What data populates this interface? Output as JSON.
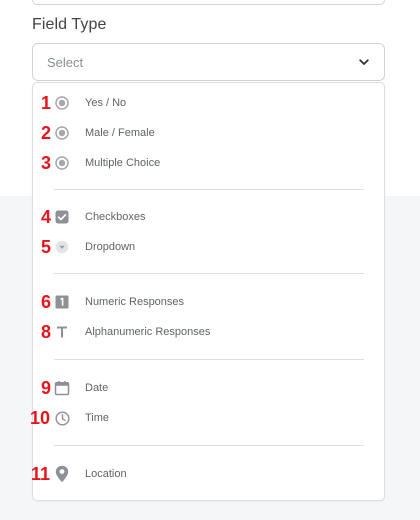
{
  "field_type": {
    "label": "Field Type",
    "select_value": "Select"
  },
  "options": [
    {
      "number": "1",
      "label": "Yes / No",
      "icon": "radio-icon"
    },
    {
      "number": "2",
      "label": "Male / Female",
      "icon": "radio-icon"
    },
    {
      "number": "3",
      "label": "Multiple Choice",
      "icon": "radio-icon"
    },
    {
      "number": "4",
      "label": "Checkboxes",
      "icon": "checkbox-icon"
    },
    {
      "number": "5",
      "label": "Dropdown",
      "icon": "dropdown-icon"
    },
    {
      "number": "6",
      "label": "Numeric Responses",
      "icon": "numeric-icon"
    },
    {
      "number": "8",
      "label": "Alphanumeric Responses",
      "icon": "text-icon"
    },
    {
      "number": "9",
      "label": "Date",
      "icon": "calendar-icon"
    },
    {
      "number": "10",
      "label": "Time",
      "icon": "clock-icon"
    },
    {
      "number": "11",
      "label": "Location",
      "icon": "location-pin-icon"
    }
  ],
  "colors": {
    "annotation_red": "#e8141b",
    "icon_gray": "#a5a7ad",
    "icon_dark": "#8e9096"
  }
}
